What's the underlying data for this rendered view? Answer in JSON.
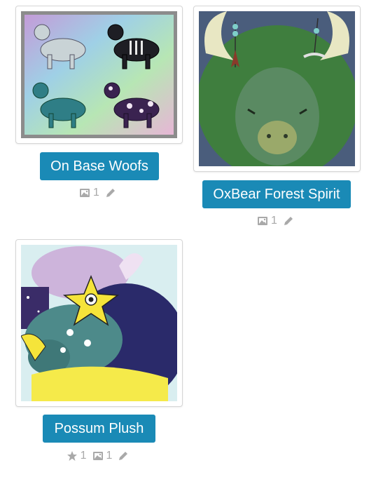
{
  "colors": {
    "accent": "#1a8ab6",
    "meta_icon": "#a9a9a9"
  },
  "cards": [
    {
      "title": "On Base Woofs",
      "image_desc": "four wolves on rainbow background",
      "meta": {
        "images": "1"
      }
    },
    {
      "title": "OxBear Forest Spirit",
      "image_desc": "green horned ox-bear creature",
      "meta": {
        "images": "1"
      }
    },
    {
      "title": "Possum Plush",
      "image_desc": "purple possum with yellow star creature",
      "meta": {
        "favorites": "1",
        "images": "1"
      }
    }
  ]
}
